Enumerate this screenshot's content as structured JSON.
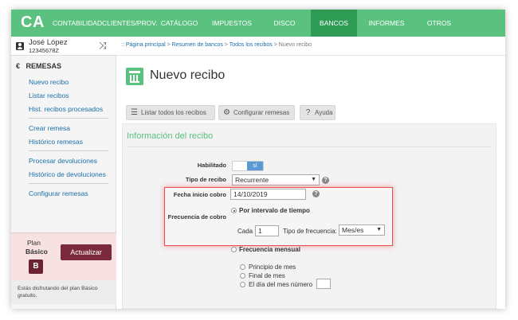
{
  "nav": {
    "logo": "CA",
    "items": [
      "CONTABILIDAD",
      "CLIENTES/PROV.",
      "CATÁLOGO",
      "IMPUESTOS",
      "DISCO VIRTUAL",
      "BANCOS",
      "INFORMES",
      "OTROS"
    ],
    "active": "BANCOS"
  },
  "user": {
    "name": "José López",
    "id": "12345678Z"
  },
  "sidebar": {
    "section": "REMESAS",
    "items": [
      "Nuevo recibo",
      "Listar recibos",
      "Hist. recibos procesados",
      "Crear remesa",
      "Histórico remesas",
      "Procesar devoluciones",
      "Histórico de devoluciones",
      "Configurar remesas"
    ]
  },
  "plan": {
    "label": "Plan",
    "name": "Básico",
    "badge": "B",
    "upgrade": "Actualizar",
    "note": "Estás disfrutando del plan Básico gratuito."
  },
  "breadcrumb": {
    "prefix": "::",
    "links": [
      "Página principal",
      "Resumen de bancos",
      "Todos los recibos"
    ],
    "current": "Nuevo recibo"
  },
  "page": {
    "title": "Nuevo recibo"
  },
  "toolbar": {
    "list": "Listar todos los recibos",
    "config": "Configurar remesas",
    "help": "Ayuda"
  },
  "form": {
    "section_title": "Información del recibo",
    "habilitado_label": "Habilitado",
    "habilitado_value": "sí",
    "tipo_label": "Tipo de recibo",
    "tipo_value": "Recurrente",
    "fecha_label": "Fecha inicio cobro",
    "fecha_value": "14/10/2019",
    "frecuencia_label": "Frecuencia de cobro",
    "opt_intervalo": "Por intervalo de tiempo",
    "cada_label": "Cada",
    "cada_value": "1",
    "tipo_frec_label": "Tipo de frecuencia:",
    "tipo_frec_value": "Mes/es",
    "opt_mensual": "Frecuencia mensual",
    "sub_opts": [
      "Principio de mes",
      "Final de mes",
      "El día del mes número"
    ]
  }
}
